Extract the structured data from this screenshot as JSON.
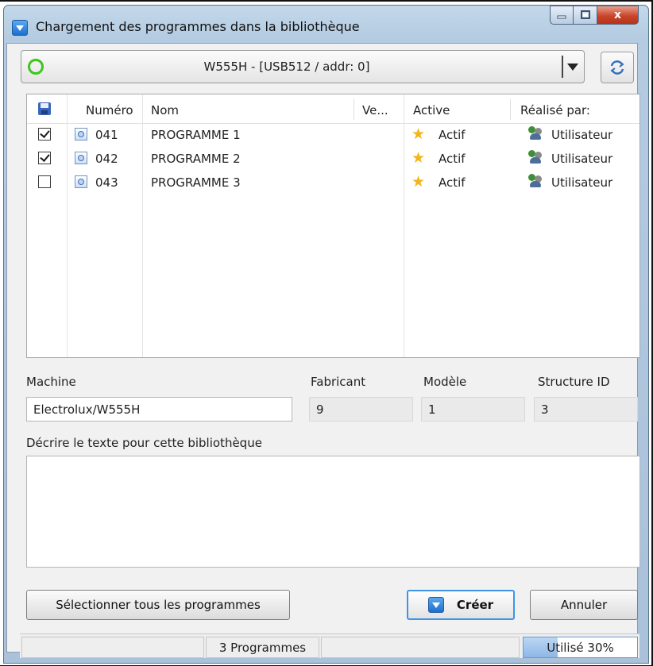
{
  "window": {
    "title": "Chargement des programmes dans la bibliothèque",
    "controls": {
      "minimize": "minimize",
      "maximize": "maximize",
      "close": "x"
    }
  },
  "device": {
    "selected": "W555H - [USB512 / addr: 0]",
    "status_color": "#3ec61d",
    "refresh_icon": "refresh-icon"
  },
  "list": {
    "columns": [
      "Numéro",
      "Nom",
      "Ve...",
      "Active",
      "Réalisé par:"
    ],
    "rows": [
      {
        "checked": true,
        "numero": "041",
        "nom": "PROGRAMME 1",
        "version": "",
        "active": "Actif",
        "realise_par": "Utilisateur"
      },
      {
        "checked": true,
        "numero": "042",
        "nom": "PROGRAMME 2",
        "version": "",
        "active": "Actif",
        "realise_par": "Utilisateur"
      },
      {
        "checked": false,
        "numero": "043",
        "nom": "PROGRAMME 3",
        "version": "",
        "active": "Actif",
        "realise_par": "Utilisateur"
      }
    ]
  },
  "details": {
    "machine_label": "Machine",
    "machine_value": "Electrolux/W555H",
    "fabricant_label": "Fabricant",
    "fabricant_value": "9",
    "modele_label": "Modèle",
    "modele_value": "1",
    "structure_label": "Structure ID",
    "structure_value": "3"
  },
  "description": {
    "label": "Décrire le texte pour cette bibliothèque",
    "value": ""
  },
  "buttons": {
    "select_all": "Sélectionner tous les programmes",
    "create": "Créer",
    "cancel": "Annuler"
  },
  "statusbar": {
    "count": "3 Programmes",
    "usage_text": "Utilisé 30%",
    "usage_fraction": 0.3
  },
  "colors": {
    "accent": "#3e95e6",
    "star": "#f2b51a",
    "close": "#c9452b"
  }
}
